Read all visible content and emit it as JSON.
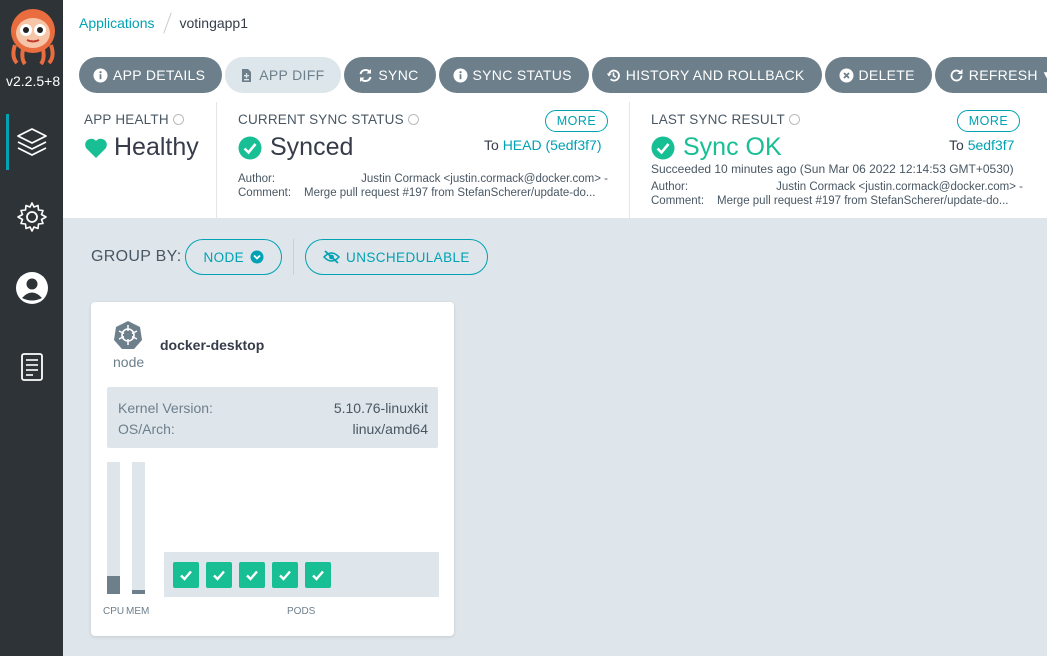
{
  "sidebar": {
    "version": "v2.2.5+8",
    "nav": [
      "applications-icon",
      "settings-icon",
      "user-icon",
      "docs-icon"
    ]
  },
  "breadcrumb": {
    "root": "Applications",
    "current": "votingapp1"
  },
  "toolbar": {
    "app_details": "APP DETAILS",
    "app_diff": "APP DIFF",
    "sync": "SYNC",
    "sync_status": "SYNC STATUS",
    "history": "HISTORY AND ROLLBACK",
    "delete": "DELETE",
    "refresh": "REFRESH"
  },
  "health": {
    "title": "APP HEALTH",
    "value": "Healthy"
  },
  "current_sync": {
    "title": "CURRENT SYNC STATUS",
    "more": "MORE",
    "value": "Synced",
    "to_prefix": "To",
    "revision": "HEAD (5edf3f7)",
    "author_label": "Author:",
    "author": "Justin Cormack <justin.cormack@docker.com> -",
    "comment_label": "Comment:",
    "comment": "Merge pull request #197 from StefanScherer/update-do..."
  },
  "last_sync": {
    "title": "LAST SYNC RESULT",
    "more": "MORE",
    "value": "Sync OK",
    "to_prefix": "To",
    "revision": "5edf3f7",
    "succeeded": "Succeeded 10 minutes ago (Sun Mar 06 2022 12:14:53 GMT+0530)",
    "author_label": "Author:",
    "author": "Justin Cormack <justin.cormack@docker.com> -",
    "comment_label": "Comment:",
    "comment": "Merge pull request #197 from StefanScherer/update-do..."
  },
  "group_by": {
    "label": "GROUP BY:",
    "node": "NODE",
    "unschedulable": "UNSCHEDULABLE"
  },
  "node_card": {
    "kind": "node",
    "name": "docker-desktop",
    "kernel_label": "Kernel Version:",
    "kernel_value": "5.10.76-linuxkit",
    "os_label": "OS/Arch:",
    "os_value": "linux/amd64",
    "cpu_label": "CPU",
    "mem_label": "MEM",
    "cpu_fraction": 0.14,
    "mem_fraction": 0.03,
    "pods_label": "PODS",
    "pod_count": 5
  },
  "colors": {
    "accent": "#00a2b3",
    "healthy": "#18be94",
    "button": "#6d7f8b",
    "sidebar": "#2e3337"
  }
}
